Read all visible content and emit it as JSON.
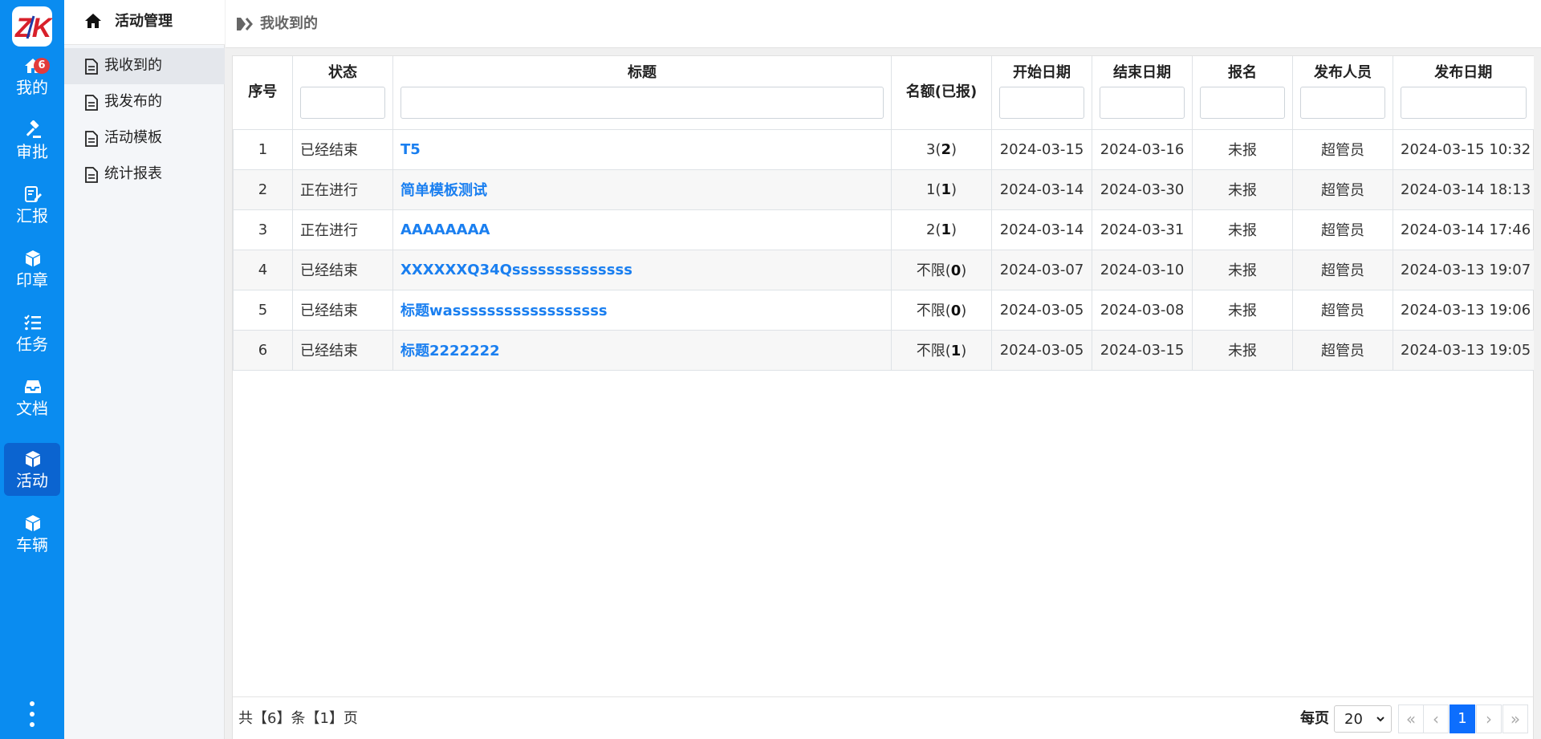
{
  "colors": {
    "rail": "#0a8cf0",
    "rail_active": "#0b64d0",
    "link": "#1a7ff0",
    "badge": "#e23b3b",
    "page_active": "#0d6efd"
  },
  "rail": {
    "logo_text": "ZK",
    "items": [
      {
        "label": "我的",
        "icon": "home-icon",
        "badge": "6"
      },
      {
        "label": "审批",
        "icon": "gavel-icon"
      },
      {
        "label": "汇报",
        "icon": "report-edit-icon"
      },
      {
        "label": "印章",
        "icon": "cube-icon"
      },
      {
        "label": "任务",
        "icon": "task-list-icon"
      },
      {
        "label": "文档",
        "icon": "inbox-icon"
      },
      {
        "label": "活动",
        "icon": "cube-icon",
        "active": true
      },
      {
        "label": "车辆",
        "icon": "cube-icon"
      }
    ],
    "more_icon": "more-vertical-icon"
  },
  "sidebar": {
    "title": "活动管理",
    "items": [
      {
        "label": "我收到的",
        "active": true
      },
      {
        "label": "我发布的"
      },
      {
        "label": "活动模板"
      },
      {
        "label": "统计报表"
      }
    ]
  },
  "breadcrumb": {
    "current": "我收到的"
  },
  "table": {
    "headers": {
      "index": "序号",
      "status": "状态",
      "title": "标题",
      "quota": "名额(已报)",
      "start": "开始日期",
      "end": "结束日期",
      "signup": "报名",
      "publisher": "发布人员",
      "publish_date": "发布日期"
    },
    "rows": [
      {
        "index": "1",
        "status": "已经结束",
        "title": "T5",
        "quota_prefix": "3(",
        "quota_count": "2",
        "quota_suffix": ")",
        "start": "2024-03-15",
        "end": "2024-03-16",
        "signup": "未报",
        "publisher": "超管员",
        "publish_date": "2024-03-15 10:32"
      },
      {
        "index": "2",
        "status": "正在进行",
        "title": "简单模板测试",
        "quota_prefix": "1(",
        "quota_count": "1",
        "quota_suffix": ")",
        "start": "2024-03-14",
        "end": "2024-03-30",
        "signup": "未报",
        "publisher": "超管员",
        "publish_date": "2024-03-14 18:13"
      },
      {
        "index": "3",
        "status": "正在进行",
        "title": "AAAAAAAA",
        "quota_prefix": "2(",
        "quota_count": "1",
        "quota_suffix": ")",
        "start": "2024-03-14",
        "end": "2024-03-31",
        "signup": "未报",
        "publisher": "超管员",
        "publish_date": "2024-03-14 17:46"
      },
      {
        "index": "4",
        "status": "已经结束",
        "title": "XXXXXXQ34Qssssssssssssss",
        "quota_prefix": "不限(",
        "quota_count": "0",
        "quota_suffix": ")",
        "start": "2024-03-07",
        "end": "2024-03-10",
        "signup": "未报",
        "publisher": "超管员",
        "publish_date": "2024-03-13 19:07"
      },
      {
        "index": "5",
        "status": "已经结束",
        "title": "标题wassssssssssssssssss",
        "quota_prefix": "不限(",
        "quota_count": "0",
        "quota_suffix": ")",
        "start": "2024-03-05",
        "end": "2024-03-08",
        "signup": "未报",
        "publisher": "超管员",
        "publish_date": "2024-03-13 19:06"
      },
      {
        "index": "6",
        "status": "已经结束",
        "title": "标题2222222",
        "quota_prefix": "不限(",
        "quota_count": "1",
        "quota_suffix": ")",
        "start": "2024-03-05",
        "end": "2024-03-15",
        "signup": "未报",
        "publisher": "超管员",
        "publish_date": "2024-03-13 19:05"
      }
    ]
  },
  "footer": {
    "summary": "共【6】条【1】页",
    "per_page_label": "每页",
    "per_page_value": "20",
    "pager": {
      "first": "«",
      "prev": "‹",
      "current": "1",
      "next": "›",
      "last": "»"
    }
  }
}
